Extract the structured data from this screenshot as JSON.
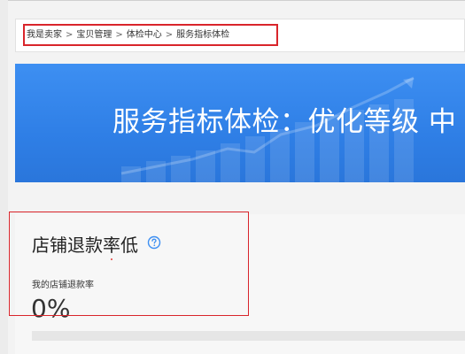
{
  "breadcrumb": {
    "items": [
      {
        "label": "我是卖家"
      },
      {
        "label": "宝贝管理"
      },
      {
        "label": "体检中心"
      },
      {
        "label": "服务指标体检"
      }
    ],
    "separator": ">"
  },
  "banner": {
    "title": "服务指标体检：优化等级 中"
  },
  "section": {
    "title": "店铺退款率低",
    "help_icon": "question-circle-icon",
    "metric_label": "我的店铺退款率",
    "metric_value": "0%",
    "progress_fraction": 0
  },
  "colors": {
    "banner_blue": "#3d8ff2",
    "help_icon_blue": "#3d8ff2",
    "highlight_red": "#d9252b"
  }
}
